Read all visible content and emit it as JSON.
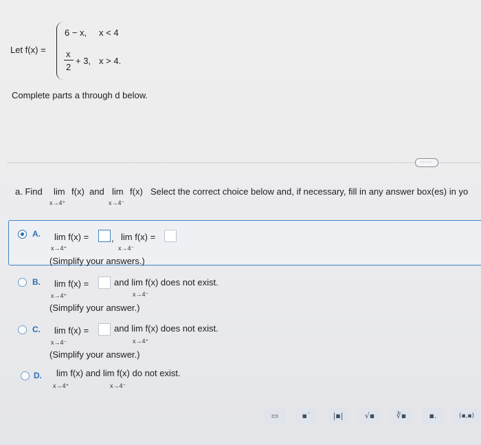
{
  "problem": {
    "prefix": "Let f(x) =",
    "piece1_expr": "6 − x,",
    "piece1_cond": "x < 4",
    "piece2_num": "x",
    "piece2_den": "2",
    "piece2_rest": "+ 3,",
    "piece2_cond": "x > 4.",
    "instruction": "Complete parts a through d below."
  },
  "more_button": "·····",
  "part_a": {
    "prompt_start": "a. Find",
    "lim_word": "lim",
    "fx": "f(x)",
    "and": "and",
    "sub_right": "x→4⁺",
    "sub_left": "x→4⁻",
    "prompt_end": "Select the correct choice below and, if necessary, fill in any answer box(es) in yo"
  },
  "choices": [
    {
      "letter": "A.",
      "selected": true,
      "lim1": "lim  f(x) =",
      "sub1": "x→4⁺",
      "sep": ",",
      "lim2": "lim  f(x) =",
      "sub2": "x→4⁻",
      "note": "(Simplify your answers.)"
    },
    {
      "letter": "B.",
      "selected": false,
      "lim1": "lim  f(x) =",
      "sub1": "x→4⁺",
      "tail": "and  lim  f(x) does not exist.",
      "sub2": "x→4⁻",
      "note": "(Simplify your answer.)"
    },
    {
      "letter": "C.",
      "selected": false,
      "lim1": "lim  f(x) =",
      "sub1": "x→4⁻",
      "tail": "and  lim  f(x) does not exist.",
      "sub2": "x→4⁺",
      "note": "(Simplify your answer.)"
    },
    {
      "letter": "D.",
      "selected": false,
      "text": "lim  f(x) and  lim  f(x) do not exist.",
      "sub1": "x→4⁺",
      "sub2": "x→4⁻"
    }
  ],
  "toolbar": [
    {
      "icon": "fraction-icon",
      "glyph": "▭"
    },
    {
      "icon": "superscript-icon",
      "glyph": "▪˙"
    },
    {
      "icon": "absolute-value-icon",
      "glyph": "|▪|"
    },
    {
      "icon": "square-root-icon",
      "glyph": "√▪"
    },
    {
      "icon": "nth-root-icon",
      "glyph": "∛▪"
    },
    {
      "icon": "decimal-icon",
      "glyph": "▪."
    },
    {
      "icon": "interval-icon",
      "glyph": "(▪,▪)"
    }
  ]
}
